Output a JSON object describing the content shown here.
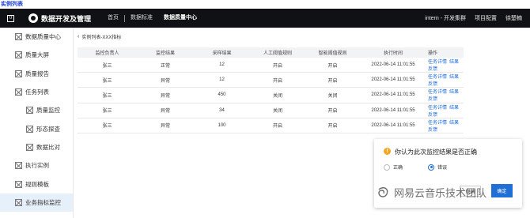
{
  "page_label": "实例列表",
  "topbar": {
    "logo_mark": "0",
    "brand": "数据开发及管理",
    "nav": [
      "首页",
      "数据标准",
      "数据质量中心"
    ],
    "right": [
      "intern - 开发集群",
      "项目配置",
      "徐楚楠"
    ]
  },
  "sidebar": {
    "items": [
      {
        "label": "数据质量中心",
        "sub": false,
        "active": false
      },
      {
        "label": "质量大屏",
        "sub": false,
        "active": false
      },
      {
        "label": "质量报告",
        "sub": false,
        "active": false
      },
      {
        "label": "任务列表",
        "sub": false,
        "active": false
      },
      {
        "label": "质量监控",
        "sub": true,
        "active": false
      },
      {
        "label": "形态探查",
        "sub": true,
        "active": false
      },
      {
        "label": "数据比对",
        "sub": true,
        "active": false
      },
      {
        "label": "执行实例",
        "sub": false,
        "active": false
      },
      {
        "label": "规则模板",
        "sub": false,
        "active": false
      },
      {
        "label": "业务指标监控",
        "sub": false,
        "active": true
      }
    ]
  },
  "breadcrumb": {
    "chevron": "‹",
    "text": "实例列表-XXX指标"
  },
  "table": {
    "headers": [
      "监控负责人",
      "监控结果",
      "采样结果",
      "人工阈值规则",
      "智能阈值规则",
      "执行时间",
      "操作"
    ],
    "rows": [
      [
        "张三",
        "正常",
        "12",
        "开启",
        "开启",
        "2022-06-14 11:01:55"
      ],
      [
        "张三",
        "异常",
        "12",
        "开启",
        "开启",
        "2022-06-14 11:01:55"
      ],
      [
        "张三",
        "异常",
        "450",
        "关闭",
        "关闭",
        "2022-06-14 11:01:55"
      ],
      [
        "张三",
        "异常",
        "34",
        "关闭",
        "开启",
        "2022-06-14 11:01:55"
      ],
      [
        "张三",
        "异常",
        "100",
        "开启",
        "开启",
        "2022-06-14 11:01:55"
      ]
    ],
    "actions": [
      "任务详情",
      "结果反馈"
    ]
  },
  "dialog": {
    "icon": "!",
    "title": "你认为此次监控结果是否正确",
    "options": [
      "正确",
      "错误"
    ],
    "selected": "错误",
    "cancel": "取消",
    "ok": "确定"
  },
  "watermark": "网易云音乐技术团队",
  "colors": {
    "accent": "#1f6fd6",
    "topbar": "#101114",
    "active_bg": "#e6f0fb",
    "warning": "#f5a623"
  }
}
